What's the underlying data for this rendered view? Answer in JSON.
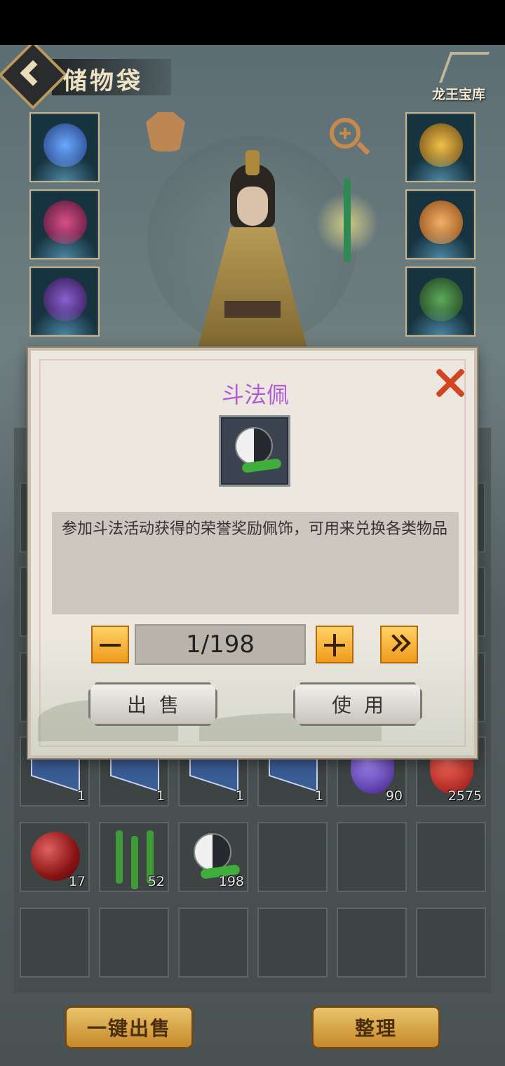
{
  "header": {
    "title": "储物袋",
    "treasury_label": "龙王宝库"
  },
  "inventory": {
    "row1_counts": [
      "1",
      "1",
      "1",
      "1",
      "90",
      "2575"
    ],
    "row2_counts": [
      "17",
      "52",
      "198"
    ]
  },
  "bottom_bar": {
    "sell_all_label": "一键出售",
    "sort_label": "整理"
  },
  "modal": {
    "item_name": "斗法佩",
    "item_name_color": "#b05bd4",
    "description": "参加斗法活动获得的荣誉奖励佩饰，可用来兑换各类物品",
    "quantity": "1/198",
    "sell_label": "出售",
    "use_label": "使用"
  },
  "colors": {
    "close_x": "#d34425",
    "qty_button": "#f09a1c"
  }
}
